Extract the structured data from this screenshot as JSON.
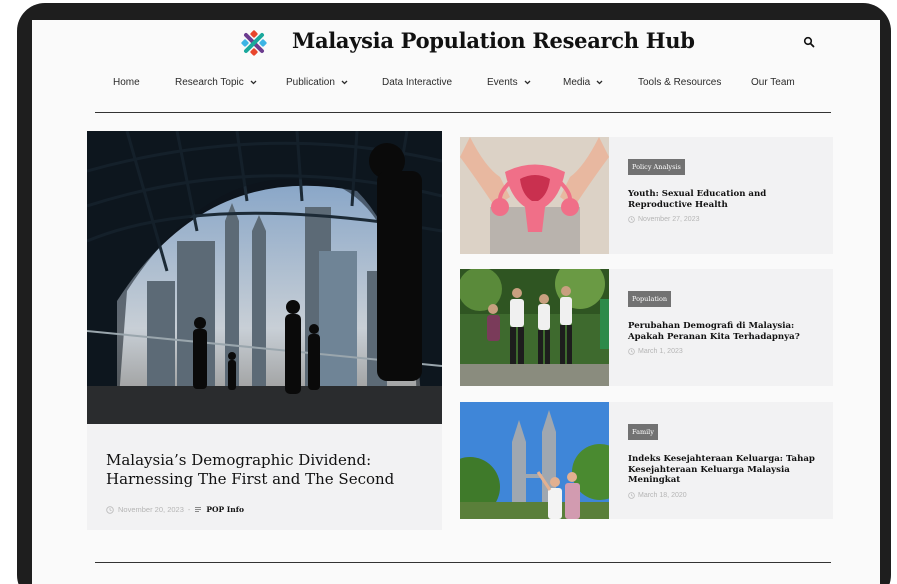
{
  "site": {
    "title": "Malaysia Population Research Hub"
  },
  "nav": [
    {
      "label": "Home"
    },
    {
      "label": "Research Topic"
    },
    {
      "label": "Publication"
    },
    {
      "label": "Data Interactive"
    },
    {
      "label": "Events"
    },
    {
      "label": "Media"
    },
    {
      "label": "Tools & Resources"
    },
    {
      "label": "Our Team"
    }
  ],
  "feature": {
    "title": "Malaysia’s Demographic Dividend: Harnessing The First and The Second",
    "date": "November 20, 2023",
    "separator": "-",
    "author": "POP Info"
  },
  "cards": [
    {
      "tag": "Policy Analysis",
      "title": "Youth: Sexual Education and Reproductive Health",
      "date": "November 27, 2023"
    },
    {
      "tag": "Population",
      "title": "Perubahan Demografi di Malaysia: Apakah Peranan Kita Terhadapnya?",
      "date": "March 1, 2023"
    },
    {
      "tag": "Family",
      "title": "Indeks Kesejahteraan Keluarga: Tahap Kesejahteraan Keluarga Malaysia Meningkat",
      "date": "March 18, 2020"
    }
  ],
  "colors": {
    "tag_bg": "#727272",
    "frame": "#1e1e1e",
    "meta": "#b5b5b5"
  },
  "icons": [
    "logo-icon",
    "search-icon",
    "chevron-down-icon",
    "clock-icon",
    "list-icon"
  ]
}
